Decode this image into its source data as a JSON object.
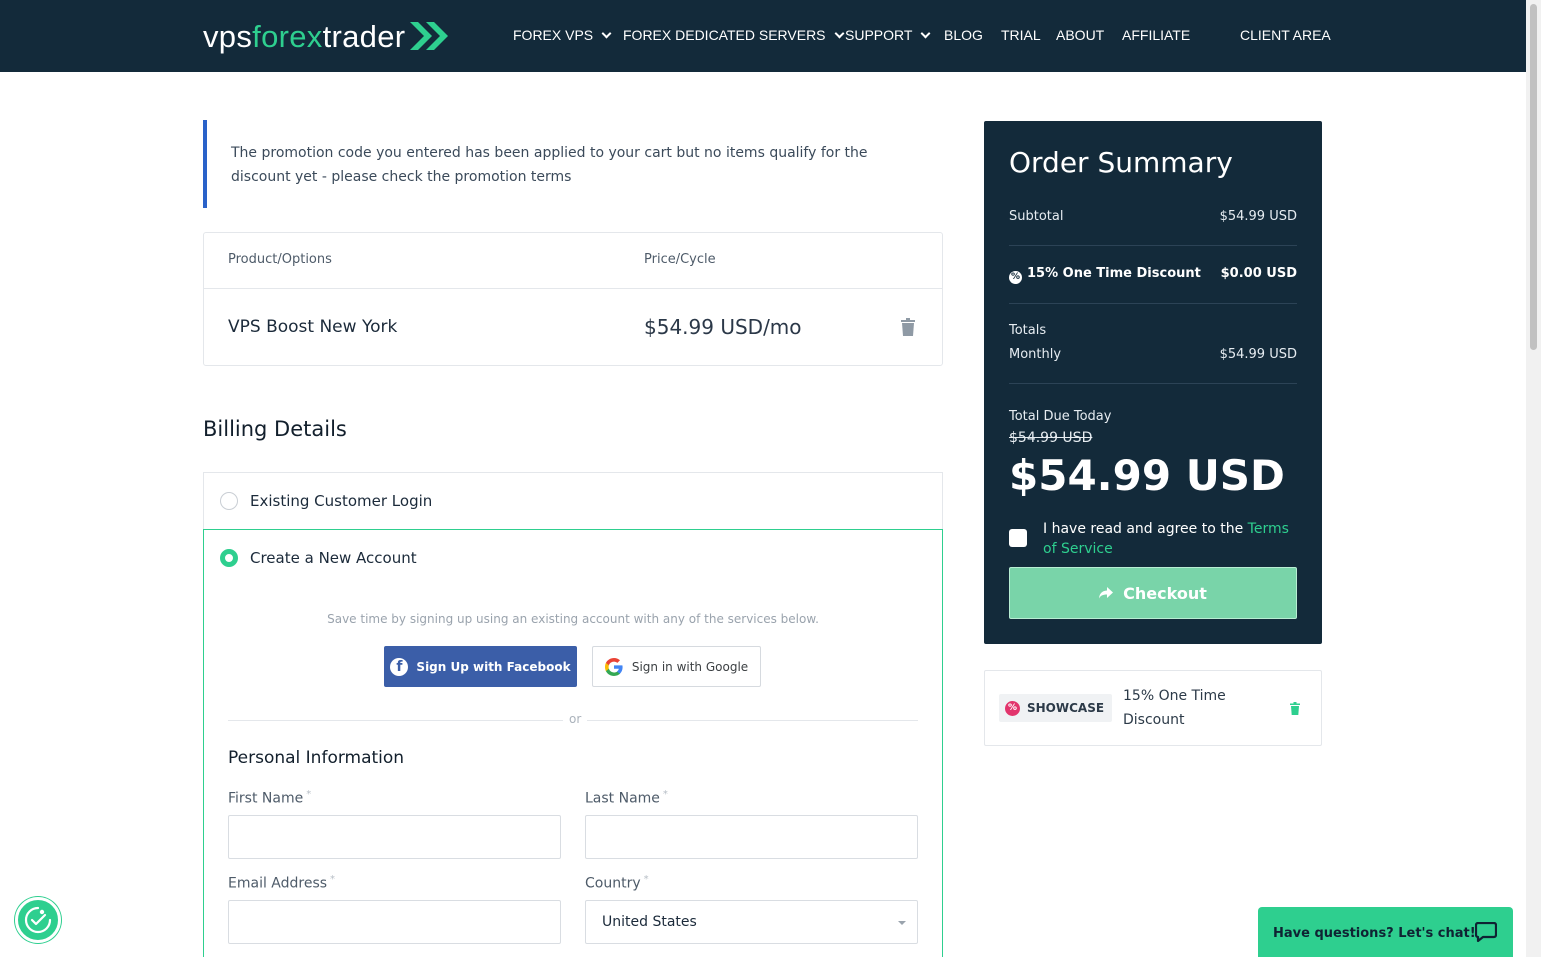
{
  "brand": {
    "logo_part1": "vps",
    "logo_part2": "forex",
    "logo_part3": "trader"
  },
  "nav": {
    "items": [
      {
        "label": "FOREX VPS",
        "dropdown": true
      },
      {
        "label": "FOREX DEDICATED SERVERS",
        "dropdown": true
      },
      {
        "label": "SUPPORT",
        "dropdown": true
      },
      {
        "label": "BLOG",
        "dropdown": false
      },
      {
        "label": "TRIAL",
        "dropdown": false
      },
      {
        "label": "ABOUT",
        "dropdown": false
      },
      {
        "label": "AFFILIATE",
        "dropdown": false
      }
    ],
    "client_area": "CLIENT AREA"
  },
  "alert": {
    "text": "The promotion code you entered has been applied to your cart but no items qualify for the discount yet - please check the promotion terms"
  },
  "cart": {
    "headers": {
      "product": "Product/Options",
      "price": "Price/Cycle"
    },
    "items": [
      {
        "name": "VPS Boost New York",
        "price": "$54.99 USD/mo"
      }
    ]
  },
  "billing": {
    "title": "Billing Details",
    "existing_login": "Existing Customer Login",
    "new_account": "Create a New Account",
    "social_hint": "Save time by signing up using an existing account with any of the services below.",
    "facebook_label": "Sign Up with Facebook",
    "google_label": "Sign in with Google",
    "or": "or",
    "personal_title": "Personal Information",
    "fields": {
      "first_name": {
        "label": "First Name",
        "value": ""
      },
      "last_name": {
        "label": "Last Name",
        "value": ""
      },
      "email": {
        "label": "Email Address",
        "value": ""
      },
      "country": {
        "label": "Country",
        "value": "United States"
      }
    },
    "required_mark": "*"
  },
  "summary": {
    "title": "Order Summary",
    "subtotal_label": "Subtotal",
    "subtotal_value": "$54.99 USD",
    "discount_label": "15% One Time Discount",
    "discount_value": "$0.00 USD",
    "totals_label": "Totals",
    "monthly_label": "Monthly",
    "monthly_value": "$54.99 USD",
    "due_label": "Total Due Today",
    "old_total": "$54.99 USD",
    "total": "$54.99 USD",
    "agree_text": "I have read and agree to the",
    "terms_link": "Terms of Service",
    "checkout_label": "Checkout"
  },
  "promo": {
    "code": "SHOWCASE",
    "description": "15% One Time Discount"
  },
  "chat": {
    "label": "Have questions? Let's chat!"
  },
  "colors": {
    "navy": "#132a3a",
    "accent_green": "#2ecf8f",
    "facebook_blue": "#3b5ea8",
    "alert_blue": "#2a62c9"
  }
}
